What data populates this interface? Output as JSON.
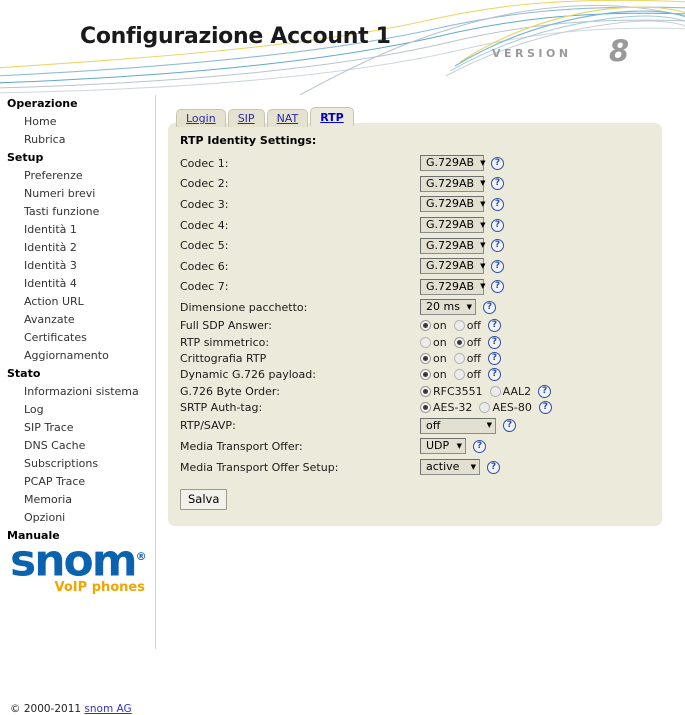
{
  "header": {
    "title": "Configurazione Account 1",
    "version_label": "VERSION",
    "version_number": "8"
  },
  "sidebar": {
    "groups": [
      {
        "heading": "Operazione",
        "items": [
          "Home",
          "Rubrica"
        ]
      },
      {
        "heading": "Setup",
        "items": [
          "Preferenze",
          "Numeri brevi",
          "Tasti funzione",
          "Identità 1",
          "Identità 2",
          "Identità 3",
          "Identità 4",
          "Action URL",
          "Avanzate",
          "Certificates",
          "Aggiornamento"
        ]
      },
      {
        "heading": "Stato",
        "items": [
          "Informazioni sistema",
          "Log",
          "SIP Trace",
          "DNS Cache",
          "Subscriptions",
          "PCAP Trace",
          "Memoria",
          "Opzioni"
        ]
      },
      {
        "heading": "Manuale",
        "items": []
      }
    ],
    "logo": {
      "word": "snom",
      "registered": "®",
      "tagline": "VoIP phones"
    },
    "copyright_prefix": "© 2000-2011",
    "copyright_link": "snom AG"
  },
  "tabs": [
    {
      "label": "Login",
      "active": false
    },
    {
      "label": "SIP",
      "active": false
    },
    {
      "label": "NAT",
      "active": false
    },
    {
      "label": "RTP",
      "active": true
    }
  ],
  "panel": {
    "section_title": "RTP Identity Settings:",
    "help_glyph": "?",
    "select_arrow": "▼",
    "codec_rows": [
      {
        "label": "Codec 1:",
        "value": "G.729AB"
      },
      {
        "label": "Codec 2:",
        "value": "G.729AB"
      },
      {
        "label": "Codec 3:",
        "value": "G.729AB"
      },
      {
        "label": "Codec 4:",
        "value": "G.729AB"
      },
      {
        "label": "Codec 5:",
        "value": "G.729AB"
      },
      {
        "label": "Codec 6:",
        "value": "G.729AB"
      },
      {
        "label": "Codec 7:",
        "value": "G.729AB"
      }
    ],
    "packet_size": {
      "label": "Dimensione pacchetto:",
      "value": "20 ms"
    },
    "radio_rows": [
      {
        "label": "Full SDP Answer:",
        "opt1": "on",
        "opt2": "off",
        "selected": 1
      },
      {
        "label": "RTP simmetrico:",
        "opt1": "on",
        "opt2": "off",
        "selected": 2
      },
      {
        "label": "Crittografia RTP",
        "opt1": "on",
        "opt2": "off",
        "selected": 1
      },
      {
        "label": "Dynamic G.726 payload:",
        "opt1": "on",
        "opt2": "off",
        "selected": 1
      },
      {
        "label": "G.726 Byte Order:",
        "opt1": "RFC3551",
        "opt2": "AAL2",
        "selected": 1
      },
      {
        "label": "SRTP Auth-tag:",
        "opt1": "AES-32",
        "opt2": "AES-80",
        "selected": 1
      }
    ],
    "savp": {
      "label": "RTP/SAVP:",
      "value": "off"
    },
    "media_transport_offer": {
      "label": "Media Transport Offer:",
      "value": "UDP"
    },
    "media_transport_offer_setup": {
      "label": "Media Transport Offer Setup:",
      "value": "active"
    },
    "save_label": "Salva"
  },
  "colors": {
    "panel_bg": "#eceadb",
    "tab_link": "#2a2aaa",
    "brand_blue": "#0b63b0",
    "brand_orange": "#f0a500"
  }
}
